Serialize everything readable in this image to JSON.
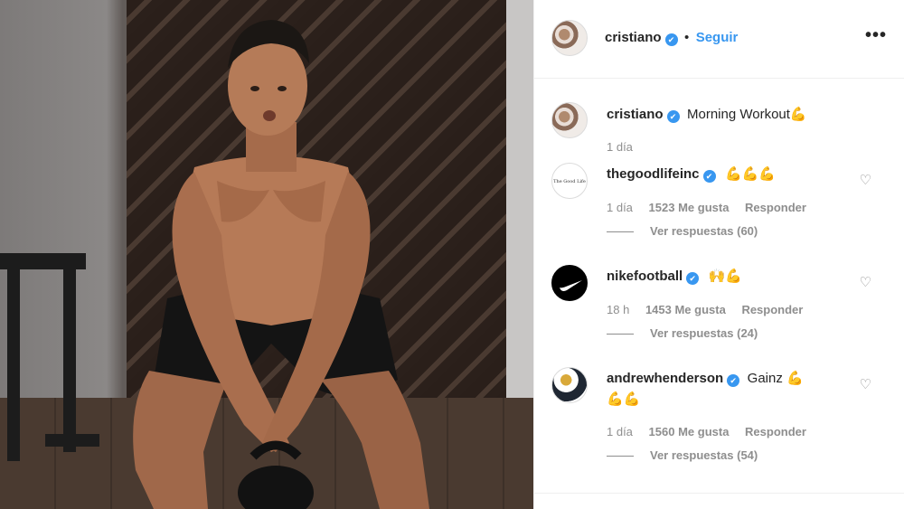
{
  "header": {
    "username": "cristiano",
    "separator": "•",
    "follow_label": "Seguir",
    "more_label": "•••"
  },
  "caption": {
    "username": "cristiano",
    "text": "Morning Workout",
    "emoji": "💪",
    "time": "1 día"
  },
  "comments": [
    {
      "username": "thegoodlifeinc",
      "text": "",
      "emoji": "💪💪💪",
      "time": "1 día",
      "likes": "1523 Me gusta",
      "reply_label": "Responder",
      "view_replies": "Ver respuestas (60)",
      "avatar_text": "The Good Life Inc"
    },
    {
      "username": "nikefootball",
      "text": "",
      "emoji": "🙌💪",
      "time": "18 h",
      "likes": "1453 Me gusta",
      "reply_label": "Responder",
      "view_replies": "Ver respuestas (24)"
    },
    {
      "username": "andrewhenderson",
      "text": "Gainz",
      "emoji": "💪",
      "emoji_line2": "💪💪",
      "time": "1 día",
      "likes": "1560 Me gusta",
      "reply_label": "Responder",
      "view_replies": "Ver respuestas (54)"
    }
  ],
  "icons": {
    "verified": "✔",
    "heart": "♡",
    "nike_swoosh": "nike-swoosh-icon"
  },
  "colors": {
    "link_blue": "#3897f0",
    "meta_gray": "#8e8e8e",
    "text_dark": "#262626"
  }
}
